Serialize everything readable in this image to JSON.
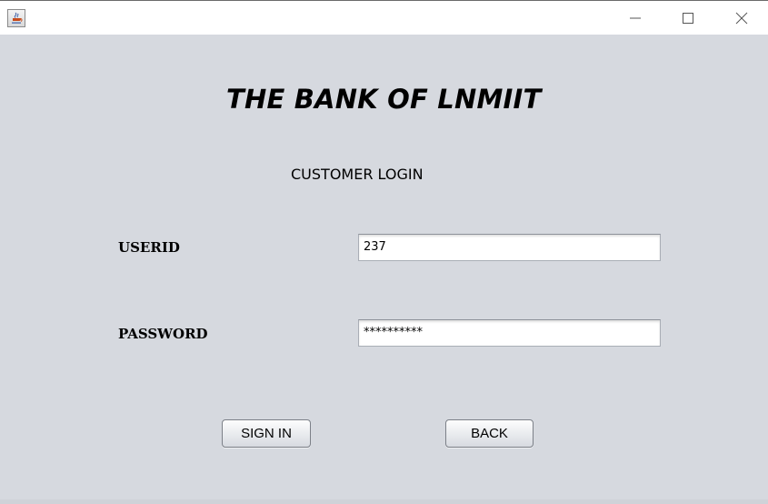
{
  "window": {
    "controls": {
      "minimize_icon": "minimize-icon",
      "maximize_icon": "maximize-icon",
      "close_icon": "close-icon"
    },
    "app_icon": "java-cup-icon"
  },
  "header": {
    "bank_title": "THE BANK OF LNMIIT",
    "subtitle": "CUSTOMER LOGIN"
  },
  "form": {
    "userid_label": "USERID",
    "userid_value": "237",
    "password_label": "PASSWORD",
    "password_value": "**********"
  },
  "actions": {
    "sign_in_label": "SIGN IN",
    "back_label": "BACK"
  },
  "colors": {
    "background": "#d6d9df",
    "titlebar": "#ffffff"
  }
}
